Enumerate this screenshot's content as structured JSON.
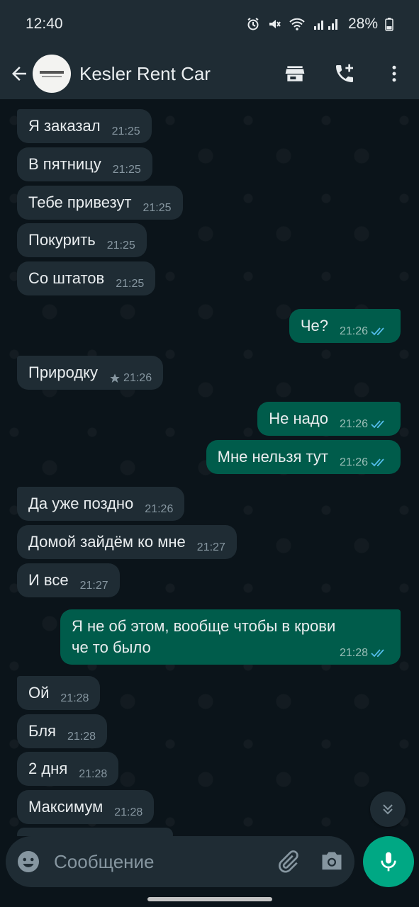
{
  "status": {
    "time": "12:40",
    "battery": "28%"
  },
  "header": {
    "contact_name": "Kesler Rent Car",
    "icons": [
      "back-arrow-icon",
      "store-icon",
      "add-call-icon",
      "more-vert-icon"
    ]
  },
  "messages": [
    {
      "dir": "in",
      "text": "Я заказал",
      "time": "21:25",
      "tail": true
    },
    {
      "dir": "in",
      "text": "В пятницу",
      "time": "21:25"
    },
    {
      "dir": "in",
      "text": "Тебе привезут",
      "time": "21:25"
    },
    {
      "dir": "in",
      "text": "Покурить",
      "time": "21:25"
    },
    {
      "dir": "in",
      "text": "Со штатов",
      "time": "21:25"
    },
    {
      "dir": "out",
      "text": "Че?",
      "time": "21:26",
      "tail": true,
      "status": "read"
    },
    {
      "dir": "in",
      "text": "Природку",
      "time": "21:26",
      "tail": true,
      "starred": true
    },
    {
      "dir": "out",
      "text": "Не надо",
      "time": "21:26",
      "tail": true,
      "status": "read"
    },
    {
      "dir": "out",
      "text": "Мне нельзя тут",
      "time": "21:26",
      "status": "read"
    },
    {
      "dir": "in",
      "text": "Да уже поздно",
      "time": "21:26",
      "tail": true
    },
    {
      "dir": "in",
      "text": "Домой зайдём ко мне",
      "time": "21:27"
    },
    {
      "dir": "in",
      "text": "И все",
      "time": "21:27"
    },
    {
      "dir": "out",
      "text_lines": [
        "Я не об этом, вообще чтобы в крови",
        "че то было"
      ],
      "time": "21:28",
      "tail": true,
      "status": "read"
    },
    {
      "dir": "in",
      "text": "Ой",
      "time": "21:28",
      "tail": true
    },
    {
      "dir": "in",
      "text": "Бля",
      "time": "21:28"
    },
    {
      "dir": "in",
      "text": "2 дня",
      "time": "21:28"
    },
    {
      "dir": "in",
      "text": "Максимум",
      "time": "21:28"
    }
  ],
  "composer": {
    "placeholder": "Сообщение",
    "icons": [
      "emoji-icon",
      "attach-icon",
      "camera-icon",
      "mic-icon"
    ]
  },
  "colors": {
    "background": "#0b141a",
    "incoming": "#1f2c34",
    "outgoing": "#005c4b",
    "accent": "#00a884",
    "read_ticks": "#53bdeb"
  }
}
